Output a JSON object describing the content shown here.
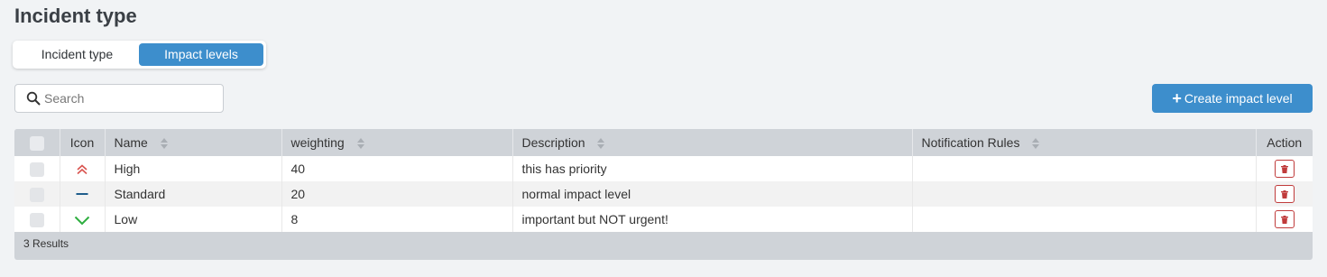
{
  "page": {
    "title": "Incident type"
  },
  "tabs": [
    {
      "label": "Incident type",
      "active": false
    },
    {
      "label": "Impact levels",
      "active": true
    }
  ],
  "search": {
    "placeholder": "Search",
    "value": ""
  },
  "toolbar": {
    "create_label": "Create impact level"
  },
  "table": {
    "columns": {
      "icon": "Icon",
      "name": "Name",
      "weighting": "weighting",
      "description": "Description",
      "notification_rules": "Notification Rules",
      "action": "Action"
    },
    "rows": [
      {
        "icon": "double-chevron-up-icon",
        "icon_color": "#d9534f",
        "name": "High",
        "weighting": "40",
        "description": "this has priority",
        "notification_rules": ""
      },
      {
        "icon": "dash-icon",
        "icon_color": "#1f5e8c",
        "name": "Standard",
        "weighting": "20",
        "description": "normal impact level",
        "notification_rules": ""
      },
      {
        "icon": "chevron-down-icon",
        "icon_color": "#2eae3f",
        "name": "Low",
        "weighting": "8",
        "description": "important but NOT urgent!",
        "notification_rules": ""
      }
    ],
    "results_text": "3 Results"
  },
  "colors": {
    "accent": "#3d8ecc",
    "danger": "#c03b3b",
    "background": "#f1f3f5",
    "table_header": "#cfd3d8"
  }
}
